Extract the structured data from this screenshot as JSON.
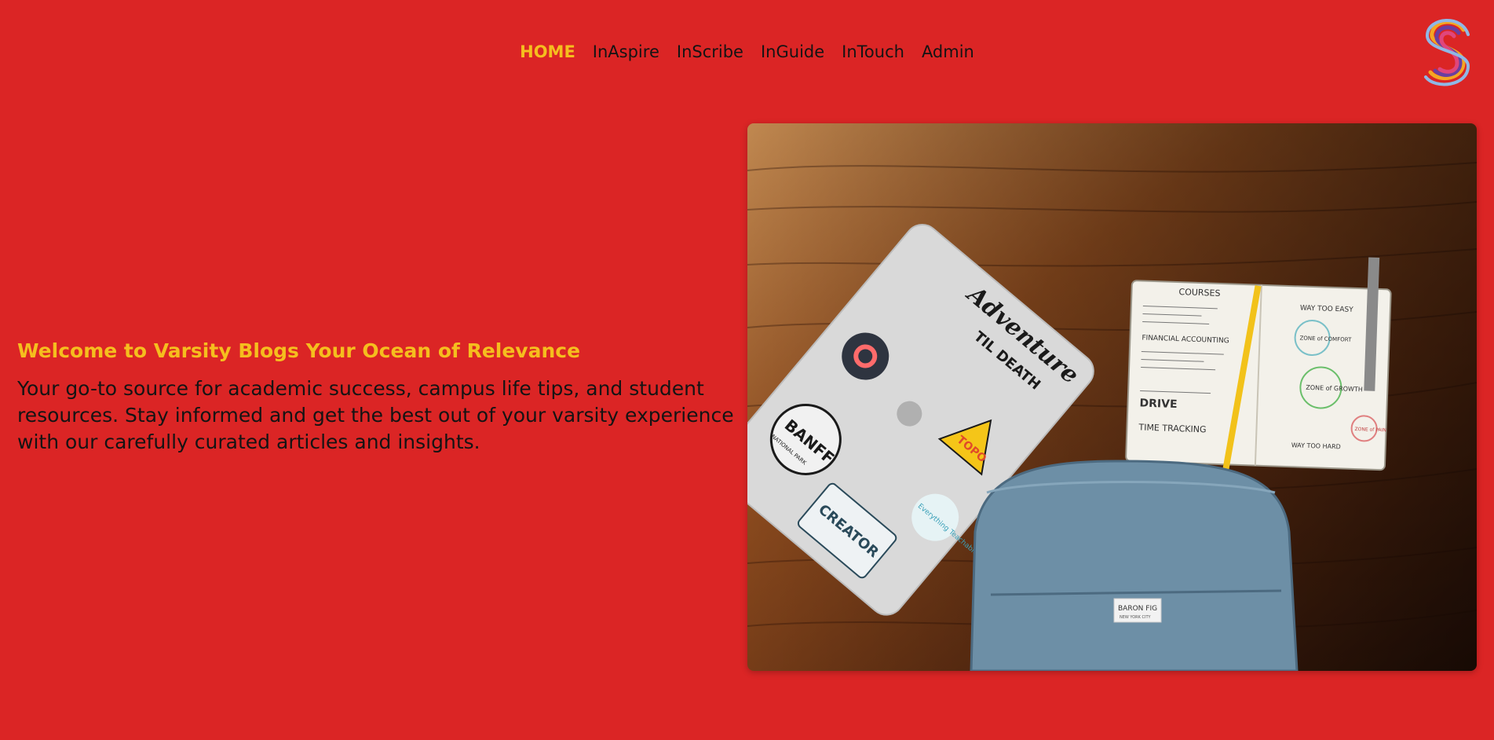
{
  "nav": {
    "items": [
      {
        "label": "HOME",
        "active": true
      },
      {
        "label": "InAspire",
        "active": false
      },
      {
        "label": "InScribe",
        "active": false
      },
      {
        "label": "InGuide",
        "active": false
      },
      {
        "label": "InTouch",
        "active": false
      },
      {
        "label": "Admin",
        "active": false
      }
    ]
  },
  "hero": {
    "title": "Welcome to Varsity Blogs Your Ocean of Relevance",
    "text": "Your go-to source for academic success, campus life tips, and student resources. Stay informed and get the best out of your varsity experience with our carefully curated articles and insights."
  },
  "image_content": {
    "sticker_adventure": "Adventure",
    "sticker_til_death": "TIL DEATH",
    "sticker_topo": "TOPO",
    "sticker_banff": "BANFF",
    "sticker_banff_sub": "NATIONAL PARK",
    "sticker_creator": "CREATOR",
    "sticker_everything": "Everything Teachable",
    "notebook_heading": "COURSES",
    "notebook_time": "TIME TRACKING",
    "notebook_drive": "DRIVE",
    "notebook_financial": "FINANCIAL ACCOUNTING",
    "notebook_zone_comfort": "ZONE of COMFORT",
    "notebook_zone_growth": "ZONE of GROWTH",
    "notebook_zone_pain": "ZONE of PAIN",
    "notebook_way_too_easy": "WAY TOO EASY",
    "notebook_way_too_hard": "WAY TOO HARD",
    "backpack_label": "BARON FIG",
    "backpack_label_sub": "NEW YORK CITY"
  },
  "colors": {
    "background": "#db2525",
    "accent": "#f5be1e",
    "text": "#141414"
  }
}
